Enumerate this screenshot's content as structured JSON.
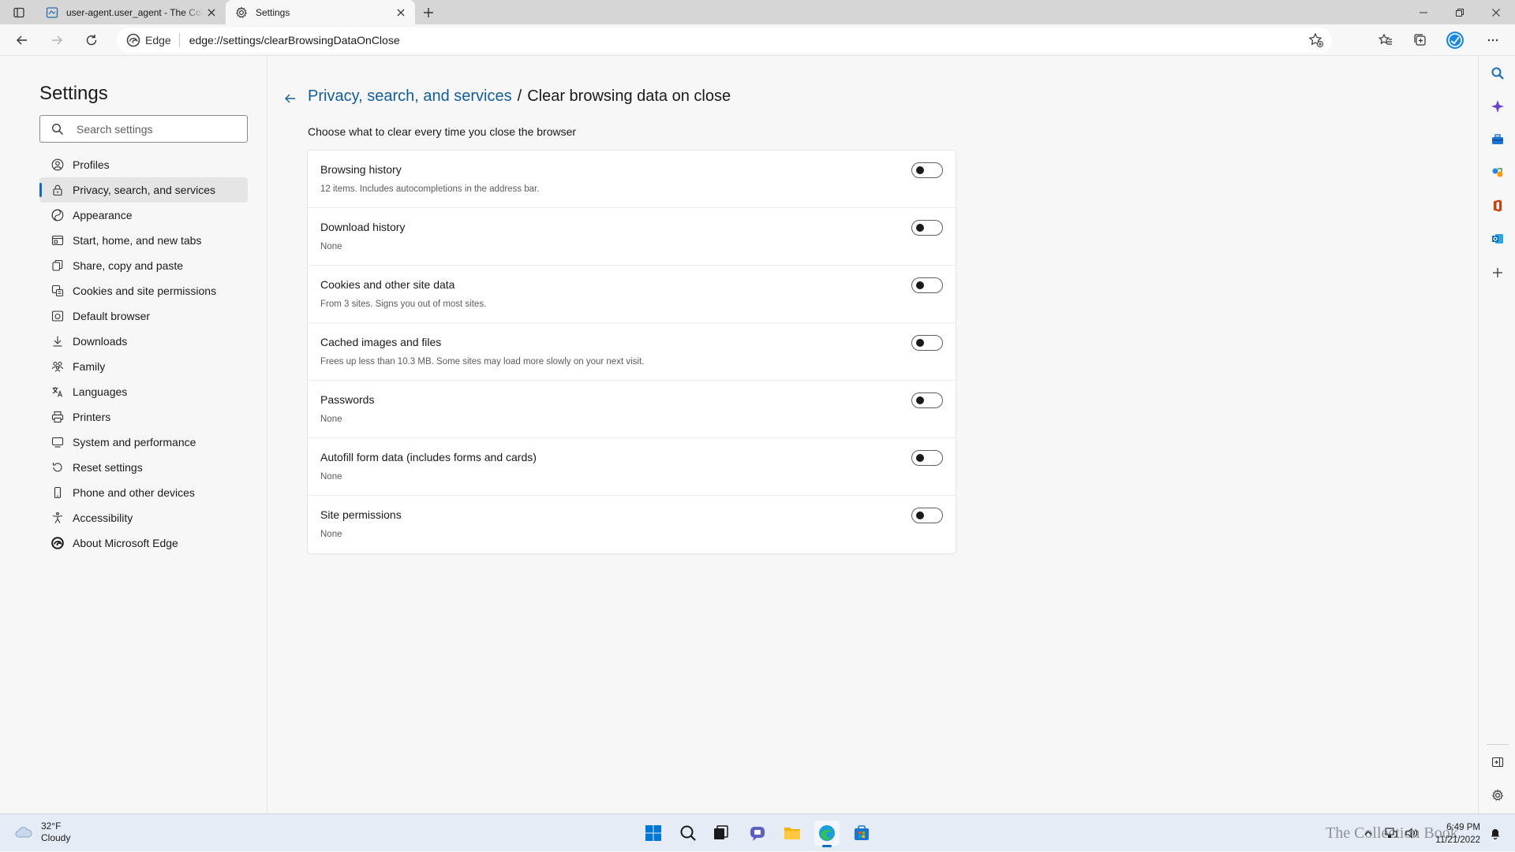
{
  "browser": {
    "tabs": [
      {
        "title": "user-agent.user_agent - The Collection Book",
        "active": false
      },
      {
        "title": "Settings",
        "active": true
      }
    ],
    "address": {
      "site_label": "Edge",
      "url": "edge://settings/clearBrowsingDataOnClose"
    }
  },
  "settings_nav": {
    "title": "Settings",
    "search_placeholder": "Search settings",
    "items": [
      {
        "label": "Profiles",
        "icon": "profile-icon"
      },
      {
        "label": "Privacy, search, and services",
        "icon": "lock-icon",
        "selected": true
      },
      {
        "label": "Appearance",
        "icon": "appearance-icon"
      },
      {
        "label": "Start, home, and new tabs",
        "icon": "home-tabs-icon"
      },
      {
        "label": "Share, copy and paste",
        "icon": "share-icon"
      },
      {
        "label": "Cookies and site permissions",
        "icon": "cookies-icon"
      },
      {
        "label": "Default browser",
        "icon": "default-browser-icon"
      },
      {
        "label": "Downloads",
        "icon": "download-icon"
      },
      {
        "label": "Family",
        "icon": "family-icon"
      },
      {
        "label": "Languages",
        "icon": "languages-icon"
      },
      {
        "label": "Printers",
        "icon": "printer-icon"
      },
      {
        "label": "System and performance",
        "icon": "system-icon"
      },
      {
        "label": "Reset settings",
        "icon": "reset-icon"
      },
      {
        "label": "Phone and other devices",
        "icon": "phone-icon"
      },
      {
        "label": "Accessibility",
        "icon": "accessibility-icon"
      },
      {
        "label": "About Microsoft Edge",
        "icon": "edge-logo-icon"
      }
    ]
  },
  "page": {
    "breadcrumb_parent": "Privacy, search, and services",
    "breadcrumb_separator": "/",
    "breadcrumb_current": "Clear browsing data on close",
    "intro": "Choose what to clear every time you close the browser",
    "rows": [
      {
        "title": "Browsing history",
        "description": "12 items. Includes autocompletions in the address bar.",
        "enabled": false
      },
      {
        "title": "Download history",
        "description": "None",
        "enabled": false
      },
      {
        "title": "Cookies and other site data",
        "description": "From 3 sites. Signs you out of most sites.",
        "enabled": false
      },
      {
        "title": "Cached images and files",
        "description": "Frees up less than 10.3 MB. Some sites may load more slowly on your next visit.",
        "enabled": false
      },
      {
        "title": "Passwords",
        "description": "None",
        "enabled": false
      },
      {
        "title": "Autofill form data (includes forms and cards)",
        "description": "None",
        "enabled": false
      },
      {
        "title": "Site permissions",
        "description": "None",
        "enabled": false
      }
    ]
  },
  "taskbar": {
    "weather": {
      "temp": "32°F",
      "condition": "Cloudy"
    },
    "clock": {
      "time": "6:49 PM",
      "date": "11/21/2022"
    },
    "watermark": "The Collection Book"
  },
  "colors": {
    "accent": "#0f6cbd",
    "link": "#115ea3",
    "background": "#f7f7f7",
    "tabstrip": "#d6d6d6",
    "taskbar": "#e5ecf6"
  }
}
